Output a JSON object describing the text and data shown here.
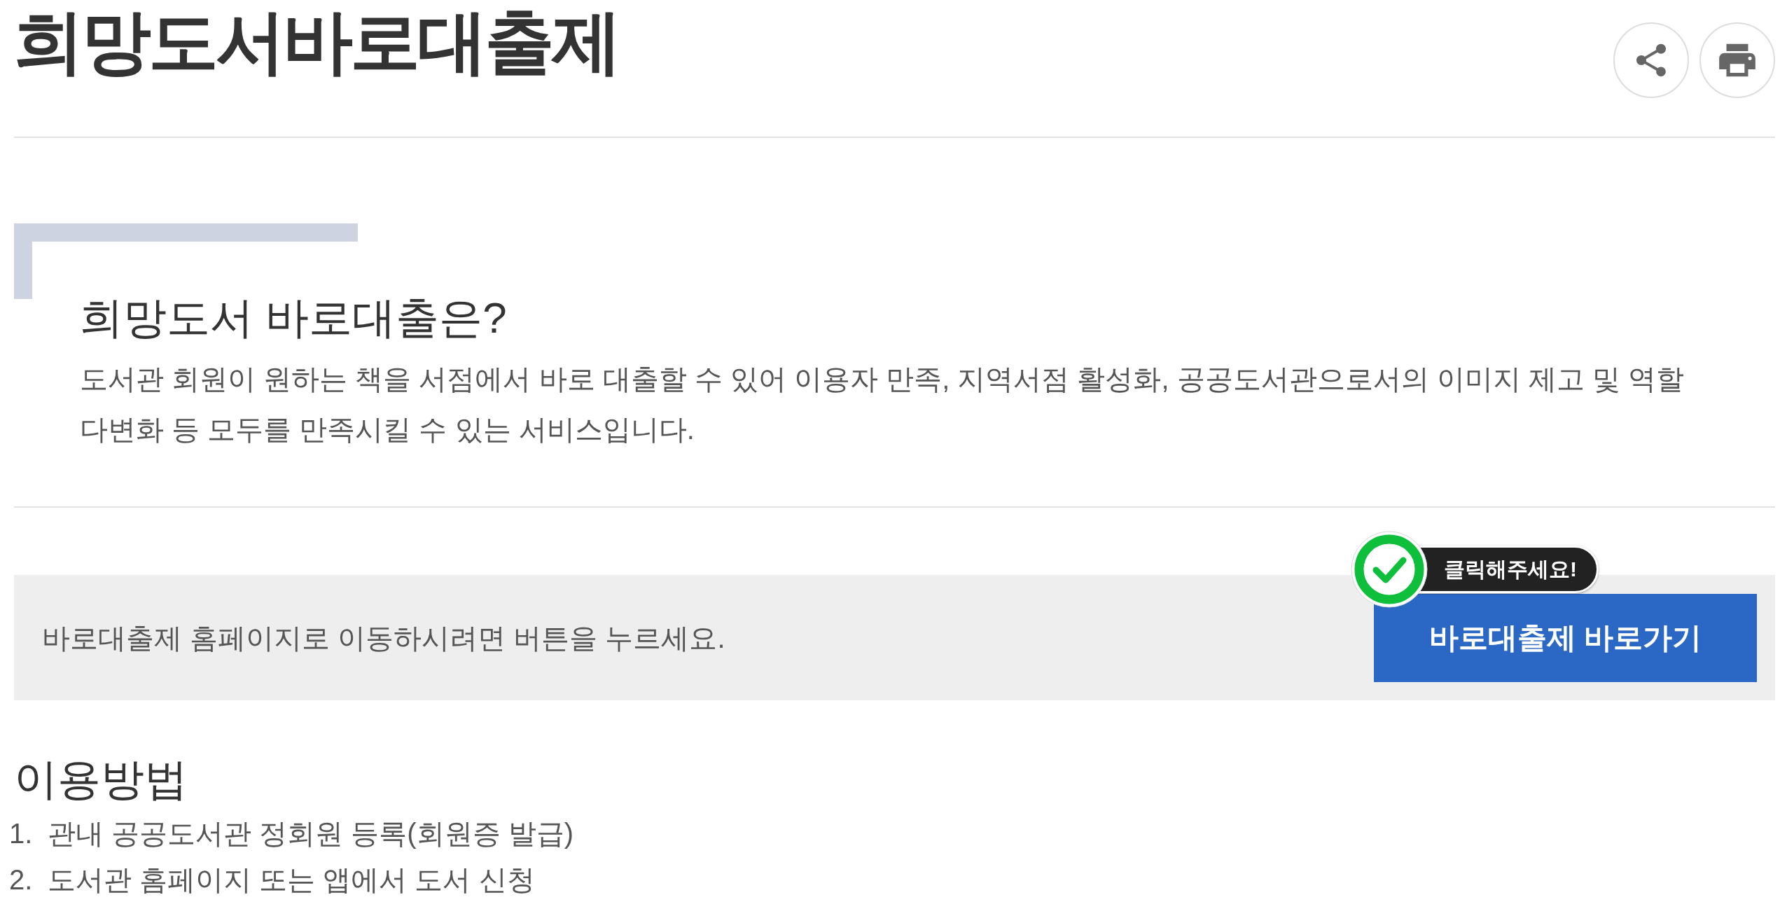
{
  "page": {
    "title": "희망도서바로대출제"
  },
  "intro": {
    "heading": "희망도서 바로대출은?",
    "text": "도서관 회원이 원하는 책을 서점에서 바로 대출할 수 있어 이용자 만족, 지역서점 활성화, 공공도서관으로서의 이미지 제고 및 역할 다변화 등 모두를 만족시킬 수 있는 서비스입니다."
  },
  "shortcut": {
    "message": "바로대출제 홈페이지로 이동하시려면 버튼을 누르세요.",
    "hint": "클릭해주세요!",
    "button": "바로대출제 바로가기"
  },
  "usage": {
    "heading": "이용방법",
    "steps": [
      {
        "number": "1.",
        "text": "관내 공공도서관 정회원 등록(회원증 발급)"
      },
      {
        "number": "2.",
        "text": "도서관 홈페이지 또는 앱에서 도서 신청"
      }
    ]
  }
}
